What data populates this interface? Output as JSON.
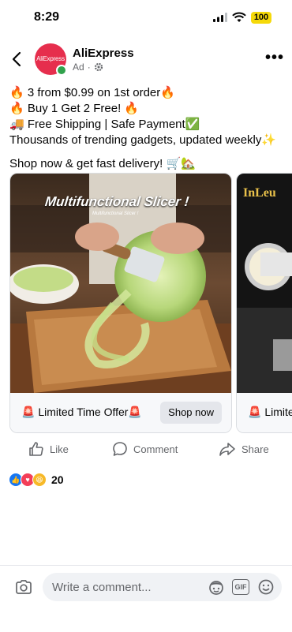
{
  "status_bar": {
    "time": "8:29",
    "battery": "100"
  },
  "post": {
    "page_name": "AliExpress",
    "avatar_text": "AliExpress",
    "sponsored": "Ad",
    "lines": [
      "🔥 3 from $0.99 on 1st order🔥",
      "🔥 Buy 1 Get 2 Free! 🔥",
      "🚚 Free Shipping | Safe Payment✅",
      "Thousands of trending gadgets, updated weekly✨",
      "Shop now & get fast delivery! 🛒🏡"
    ]
  },
  "carousel": {
    "cards": [
      {
        "image_title": "Multifunctional Slicer !",
        "image_subtitle": "Multifunctional Slicer !",
        "offer": "🚨 Limited Time Offer🚨",
        "button": "Shop now"
      },
      {
        "image_title": "InLeu",
        "offer": "🚨 Limite"
      }
    ]
  },
  "actions": {
    "like": "Like",
    "comment": "Comment",
    "share": "Share"
  },
  "reactions": {
    "count": "20"
  },
  "comment_bar": {
    "placeholder": "Write a comment..."
  },
  "colors": {
    "brand": "#e62e4d",
    "facebook_blue": "#1877f2",
    "muted": "#65676b"
  }
}
